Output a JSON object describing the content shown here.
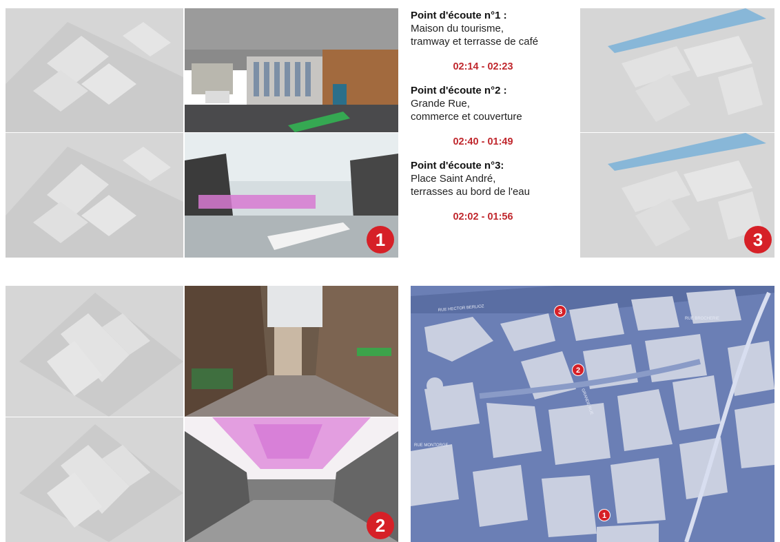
{
  "points": [
    {
      "title": "Point d'écoute n°1 :",
      "desc1": "Maison du tourisme,",
      "desc2": "tramway et terrasse de café",
      "time": "02:14 - 02:23"
    },
    {
      "title": "Point d'écoute n°2 :",
      "desc1": "Grande Rue,",
      "desc2": "commerce et couverture",
      "time": "02:40 - 01:49"
    },
    {
      "title": "Point d'écoute n°3:",
      "desc1": "Place Saint André,",
      "desc2": "terrasses au bord de l'eau",
      "time": "02:02 - 01:56"
    }
  ],
  "badges": {
    "one": "1",
    "two": "2",
    "three": "3"
  },
  "map": {
    "pins": {
      "p1": "1",
      "p2": "2",
      "p3": "3"
    },
    "street_labels": {
      "hector": "RUE HECTOR BERLIOZ",
      "brocherie": "RUE BROCHERIE",
      "montorge": "RUE MONTORGE",
      "grande": "GRANDE RUE"
    }
  },
  "colors": {
    "accent_red": "#d62027",
    "time_red": "#c0272d",
    "map_blue": "#6b7fb5",
    "map_buildings": "#c9cfe0"
  }
}
